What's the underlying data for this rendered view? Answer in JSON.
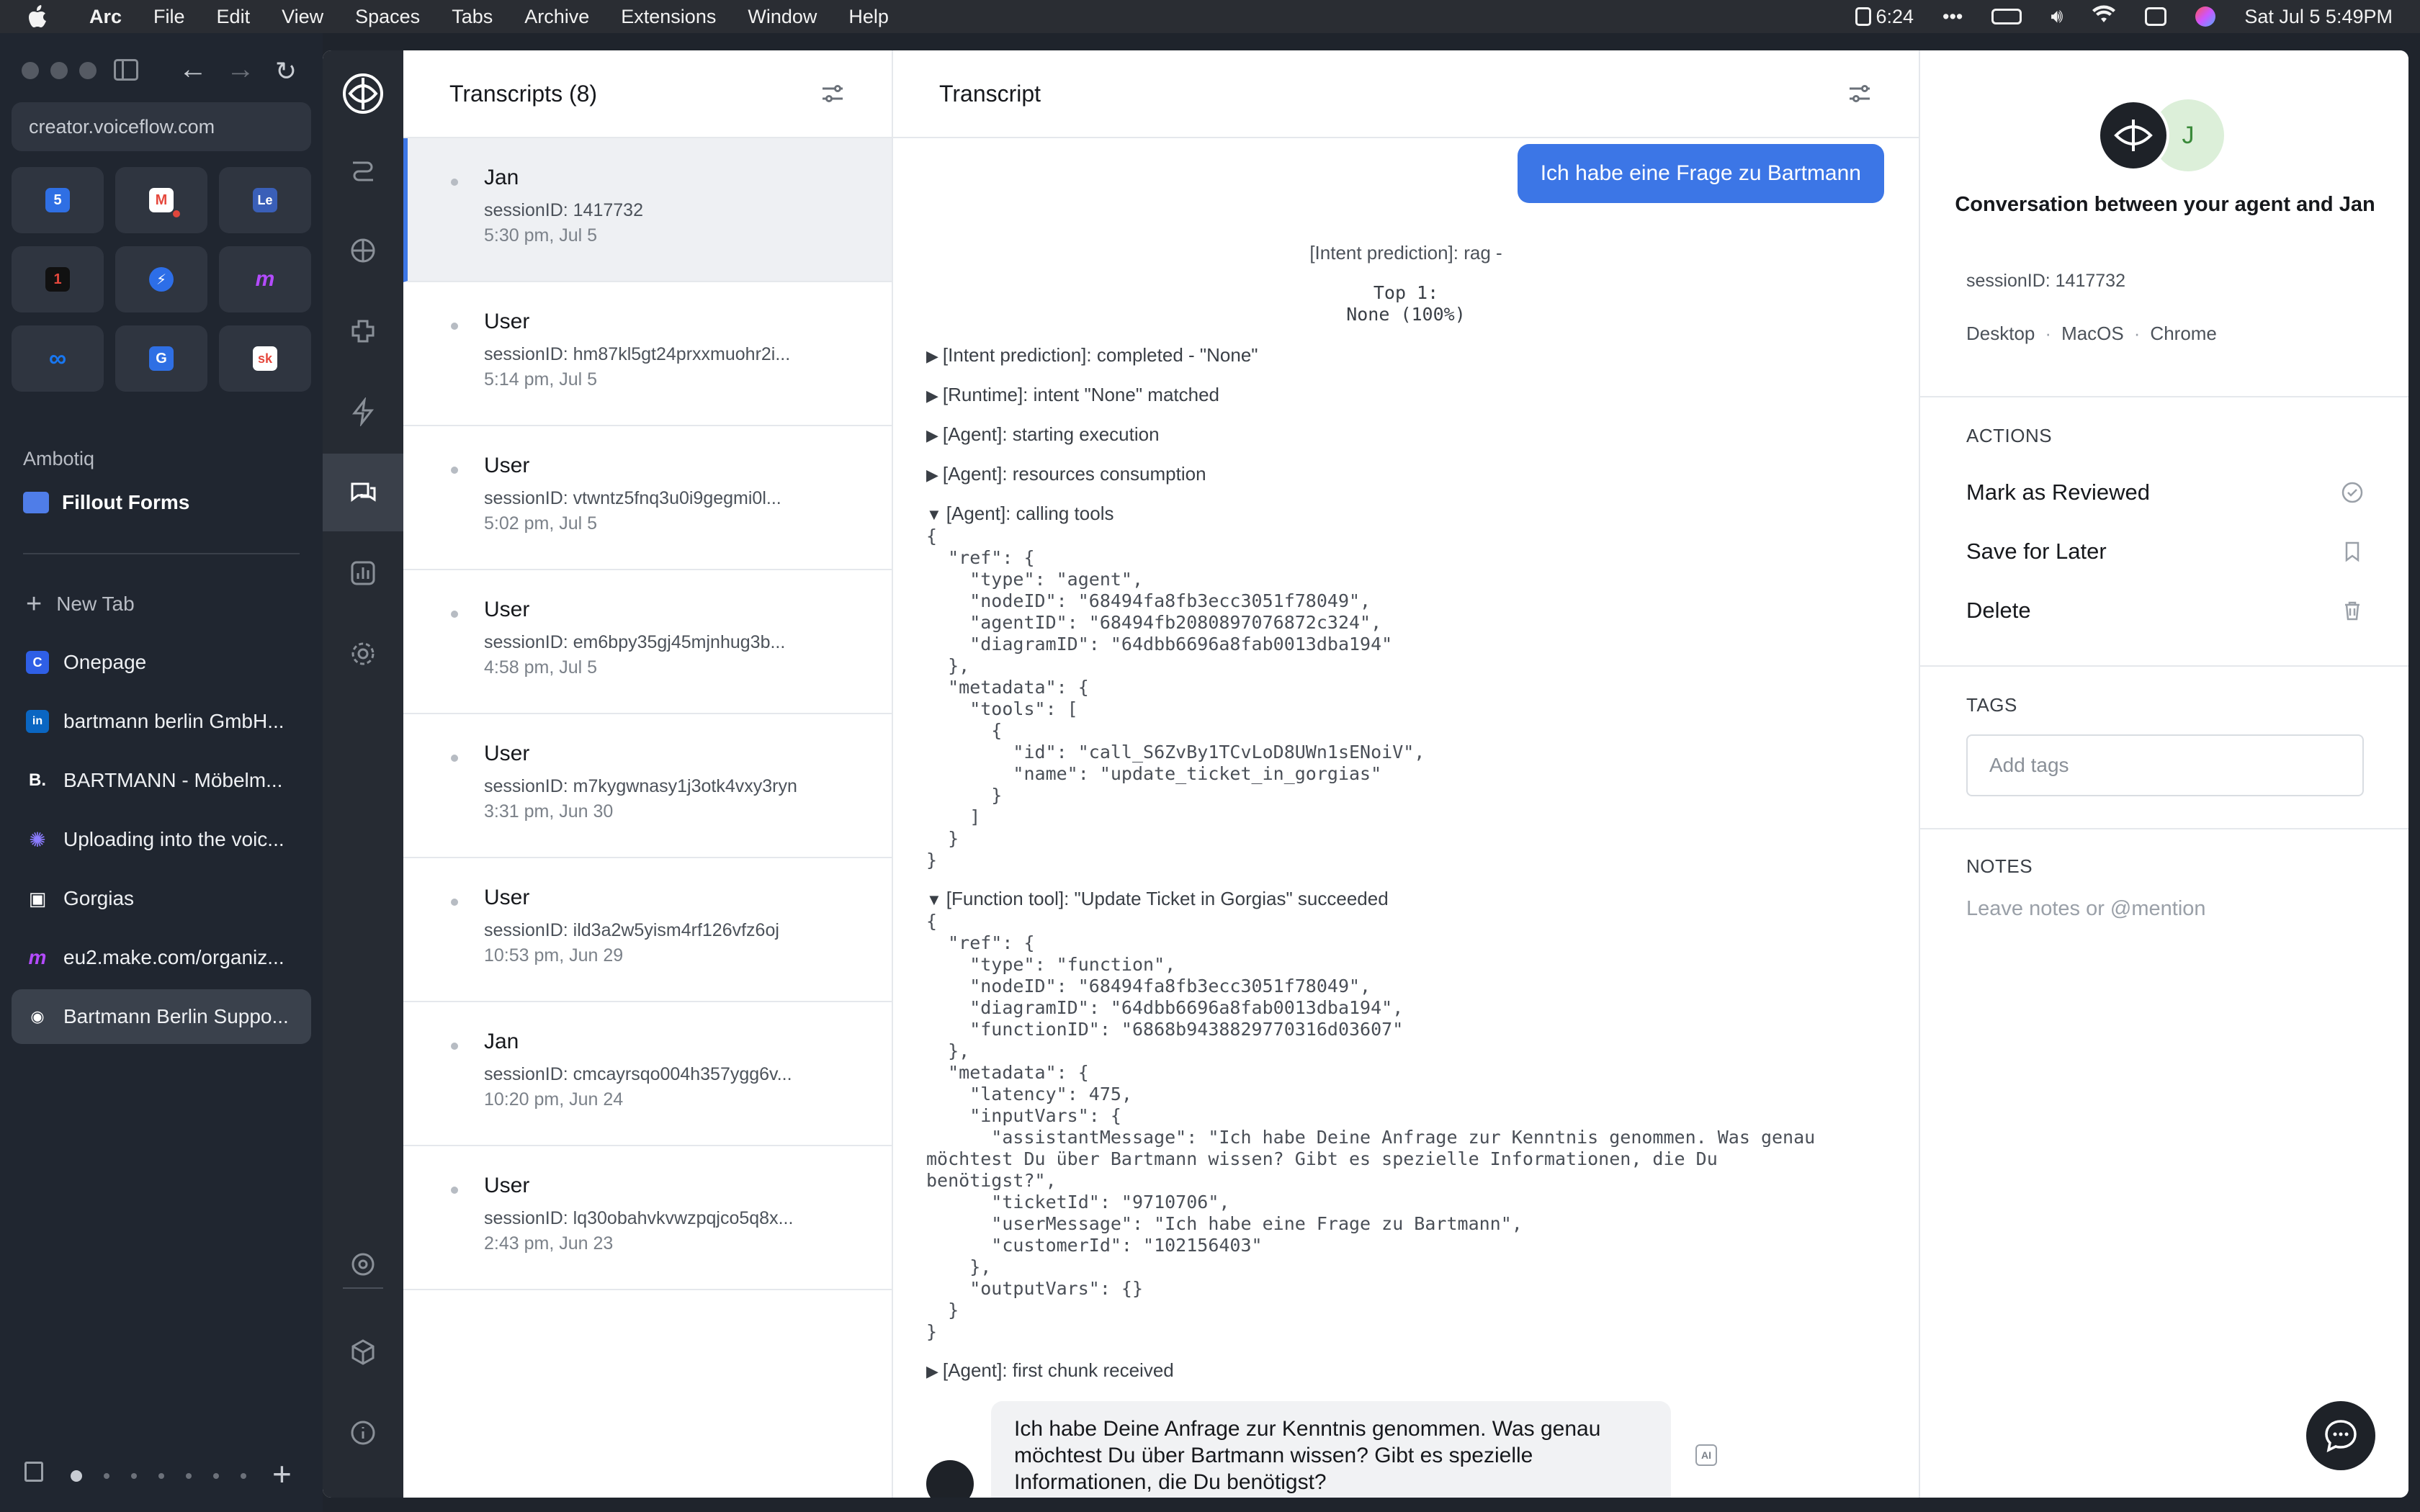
{
  "menubar": {
    "app": "Arc",
    "items": [
      "File",
      "Edit",
      "View",
      "Spaces",
      "Tabs",
      "Archive",
      "Extensions",
      "Window",
      "Help"
    ],
    "status_time_badge": "6:24",
    "date_time": "Sat Jul 5  5:49PM"
  },
  "browser": {
    "url": "creator.voiceflow.com",
    "favorites": [
      {
        "icon": "calendar-icon",
        "glyph": "5",
        "color": "#2f6fe4"
      },
      {
        "icon": "gmail-icon",
        "glyph": "M",
        "color": "#e5483d",
        "badge": true
      },
      {
        "icon": "le-icon",
        "glyph": "Le",
        "color": "#3a5fb8"
      },
      {
        "icon": "notification-app-icon",
        "glyph": "1",
        "color": "#222"
      },
      {
        "icon": "bolt-app-icon",
        "glyph": "⚡",
        "color": "#2d6ee8"
      },
      {
        "icon": "make-icon",
        "glyph": "m",
        "color": "#7b2cd8"
      },
      {
        "icon": "meta-icon",
        "glyph": "∞",
        "color": "#1877f2"
      },
      {
        "icon": "translate-icon",
        "glyph": "G",
        "color": "#2f6fe4"
      },
      {
        "icon": "sk-icon",
        "glyph": "sk",
        "color": "#e5483d"
      }
    ],
    "space_name": "Ambotiq",
    "pinned_folder": "Fillout Forms",
    "new_tab_label": "New Tab",
    "tabs": [
      {
        "label": "Onepage",
        "icon": "onepage-icon",
        "color": "#2f5fe6",
        "glyph": "C"
      },
      {
        "label": "bartmann berlin GmbH...",
        "icon": "linkedin-icon",
        "color": "#0a66c2",
        "glyph": "in"
      },
      {
        "label": "BARTMANN - Möbelm...",
        "icon": "bartmann-icon",
        "color": "#111",
        "glyph": "B."
      },
      {
        "label": "Uploading into the voic...",
        "icon": "voiceflow-star-icon",
        "color": "#6b5cff",
        "glyph": "✺"
      },
      {
        "label": "Gorgias",
        "icon": "gorgias-icon",
        "color": "#2b2f36",
        "glyph": "▣"
      },
      {
        "label": "eu2.make.com/organiz...",
        "icon": "make-icon",
        "color": "#7b2cd8",
        "glyph": "m"
      },
      {
        "label": "Bartmann Berlin Suppo...",
        "icon": "voiceflow-icon",
        "color": "#2b2f36",
        "glyph": "◉",
        "active": true
      }
    ]
  },
  "transcripts": {
    "title": "Transcripts (8)",
    "items": [
      {
        "name": "Jan",
        "session": "sessionID: 1417732",
        "time": "5:30 pm, Jul 5",
        "selected": true
      },
      {
        "name": "User",
        "session": "sessionID: hm87kl5gt24prxxmuohr2i...",
        "time": "5:14 pm, Jul 5"
      },
      {
        "name": "User",
        "session": "sessionID: vtwntz5fnq3u0i9gegmi0l...",
        "time": "5:02 pm, Jul 5"
      },
      {
        "name": "User",
        "session": "sessionID: em6bpy35gj45mjnhug3b...",
        "time": "4:58 pm, Jul 5"
      },
      {
        "name": "User",
        "session": "sessionID: m7kygwnasy1j3otk4vxy3ryn",
        "time": "3:31 pm, Jun 30"
      },
      {
        "name": "User",
        "session": "sessionID: ild3a2w5yism4rf126vfz6oj",
        "time": "10:53 pm, Jun 29"
      },
      {
        "name": "Jan",
        "session": "sessionID: cmcayrsqo004h357ygg6v...",
        "time": "10:20 pm, Jun 24"
      },
      {
        "name": "User",
        "session": "sessionID: lq30obahvkvwzpqjco5q8x...",
        "time": "2:43 pm, Jun 23"
      }
    ]
  },
  "transcript": {
    "title": "Transcript",
    "user_message": "Ich habe eine Frage zu Bartmann",
    "intent_prediction": "[Intent prediction]: rag -",
    "top_block": "Top 1:\nNone (100%)",
    "logs": {
      "l1": "[Intent prediction]: completed - \"None\"",
      "l2": "[Runtime]: intent \"None\" matched",
      "l3": "[Agent]: starting execution",
      "l4": "[Agent]: resources consumption",
      "l5": "[Agent]: calling tools",
      "l6": "[Function tool]: \"Update Ticket in Gorgias\" succeeded",
      "l7": "[Agent]: first chunk received"
    },
    "code_tools": "{\n  \"ref\": {\n    \"type\": \"agent\",\n    \"nodeID\": \"68494fa8fb3ecc3051f78049\",\n    \"agentID\": \"68494fb2080897076872c324\",\n    \"diagramID\": \"64dbb6696a8fab0013dba194\"\n  },\n  \"metadata\": {\n    \"tools\": [\n      {\n        \"id\": \"call_S6ZvBy1TCvLoD8UWn1sENoiV\",\n        \"name\": \"update_ticket_in_gorgias\"\n      }\n    ]\n  }\n}",
    "code_function": "{\n  \"ref\": {\n    \"type\": \"function\",\n    \"nodeID\": \"68494fa8fb3ecc3051f78049\",\n    \"diagramID\": \"64dbb6696a8fab0013dba194\",\n    \"functionID\": \"6868b9438829770316d03607\"\n  },\n  \"metadata\": {\n    \"latency\": 475,\n    \"inputVars\": {\n      \"assistantMessage\": \"Ich habe Deine Anfrage zur Kenntnis genommen. Was genau\nmöchtest Du über Bartmann wissen? Gibt es spezielle Informationen, die Du\nbenötigst?\",\n      \"ticketId\": \"9710706\",\n      \"userMessage\": \"Ich habe eine Frage zu Bartmann\",\n      \"customerId\": \"102156403\"\n    },\n    \"outputVars\": {}\n  }\n}",
    "agent_message": "Ich habe Deine Anfrage zur Kenntnis genommen. Was genau möchtest Du über Bartmann wissen? Gibt es spezielle Informationen, die Du benötigst?",
    "ai_badge": "AI"
  },
  "details": {
    "avatar_initial": "J",
    "title": "Conversation between your agent and Jan",
    "session": "sessionID: 1417732",
    "env": [
      "Desktop",
      "MacOS",
      "Chrome"
    ],
    "env_sep": "·",
    "actions_label": "ACTIONS",
    "actions": [
      "Mark as Reviewed",
      "Save for Later",
      "Delete"
    ],
    "tags_label": "TAGS",
    "tags_placeholder": "Add tags",
    "notes_label": "NOTES",
    "notes_placeholder": "Leave notes or @mention"
  }
}
